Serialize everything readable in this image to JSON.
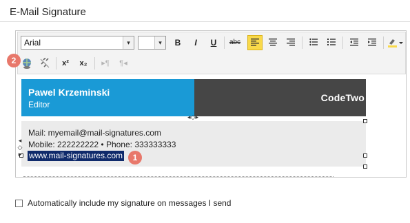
{
  "section": {
    "title": "E-Mail Signature"
  },
  "toolbar": {
    "font": "Arial",
    "font_size": "",
    "dropdown_glyph": "▾",
    "bold": "B",
    "italic": "I",
    "underline": "U",
    "strike": "abc",
    "superscript": "x²",
    "subscript": "x₂",
    "ltr": "▸¶",
    "rtl": "¶◂",
    "highlight_color": "#f9d94a",
    "active_button": "align-left"
  },
  "signature": {
    "name": "Pawel Krzeminski",
    "role": "Editor",
    "brand": "CodeTwo",
    "mail": "Mail: myemail@mail-signatures.com",
    "phone": "Mobile: 222222222 • Phone: 333333333",
    "url": "www.mail-signatures.com",
    "header_color": "#1a9ad6",
    "header_dark": "#464646",
    "body_color": "#ebebeb"
  },
  "markers": {
    "one": "1",
    "two": "2"
  },
  "auto_include": {
    "label": "Automatically include my signature on messages I send",
    "checked": false
  }
}
